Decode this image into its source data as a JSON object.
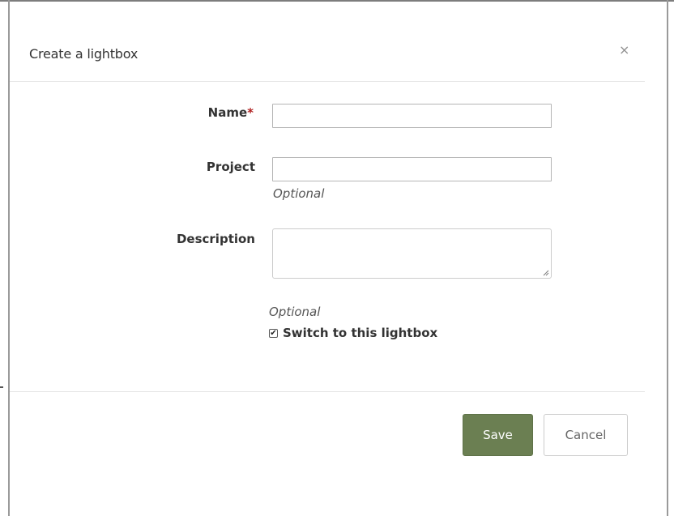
{
  "dialog": {
    "title": "Create a lightbox",
    "close_label": "×"
  },
  "form": {
    "name": {
      "label": "Name",
      "required_marker": "*",
      "value": ""
    },
    "project": {
      "label": "Project",
      "value": "",
      "help": "Optional"
    },
    "description": {
      "label": "Description",
      "value": "",
      "help": "Optional"
    },
    "switch_to_lightbox": {
      "label": "Switch to this lightbox",
      "checked": true
    }
  },
  "footer": {
    "save_label": "Save",
    "cancel_label": "Cancel"
  },
  "colors": {
    "primary_button": "#6b7f52",
    "required": "#b02020"
  }
}
